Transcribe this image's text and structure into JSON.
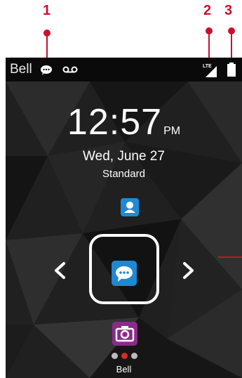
{
  "callouts": {
    "one": "1",
    "two": "2",
    "three": "3"
  },
  "status_bar": {
    "carrier": "Bell",
    "network_label": "LTE",
    "icons": [
      "message-icon",
      "voicemail-icon",
      "signal-icon",
      "battery-icon"
    ]
  },
  "clock": {
    "time": "12:57",
    "ampm": "PM"
  },
  "date": "Wed, June 27",
  "profile": "Standard",
  "apps": {
    "above": {
      "icon": "contacts-icon"
    },
    "selected": {
      "icon": "messages-icon",
      "name": "Bell"
    },
    "below": {
      "icon": "camera-icon"
    }
  },
  "page_indicator": {
    "count": 3,
    "active": 2
  },
  "colors": {
    "callout": "#c8102e",
    "status_bar": "#0a0a0a",
    "contacts": "#1e8ad6",
    "messages": "#1e88d2",
    "camera": "#8b2a8c"
  }
}
